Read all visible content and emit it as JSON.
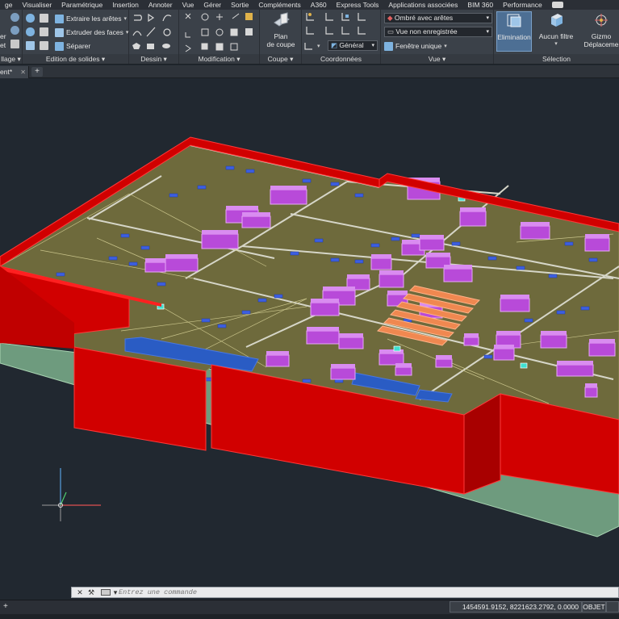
{
  "menu": {
    "items": [
      "ge",
      "Visualiser",
      "Paramétrique",
      "Insertion",
      "Annoter",
      "Vue",
      "Gérer",
      "Sortie",
      "Compléments",
      "A360",
      "Express Tools",
      "Applications associées",
      "BIM 360",
      "Performance"
    ]
  },
  "ribbon": {
    "panel_titles": {
      "maillage": "llage ▾",
      "edition_solides": "Edition de solides ▾",
      "dessin": "Dessin ▾",
      "modification": "Modification ▾",
      "coupe": "Coupe ▾",
      "coordonnees": "Coordonnées",
      "vue": "Vue ▾",
      "selection": "Sélection"
    },
    "solid_edit": {
      "extrude_edges": "Extraire les arêtes",
      "extrude_faces": "Extruder des faces",
      "separate": "Séparer"
    },
    "left_fragments": [
      "er",
      "et"
    ],
    "section_plane": {
      "line1": "Plan",
      "line2": "de coupe"
    },
    "coordinates": {
      "ucs_dropdown": "Général"
    },
    "view": {
      "visual_style": "Ombré avec arêtes",
      "named_view": "Vue non enregistrée",
      "viewport_config": "Fenêtre unique"
    },
    "selection": {
      "culling": "Elimination",
      "no_filter": "Aucun filtre",
      "gizmo_line1": "Gizmo",
      "gizmo_line2": "Déplaceme"
    }
  },
  "document_tab": {
    "label": "ent*",
    "close": "✕",
    "new_tab": "+"
  },
  "command_line": {
    "placeholder": "Entrez une commande",
    "close": "✕",
    "settings": "🔧",
    "arrow": "▾"
  },
  "status": {
    "coordinates": "1454591.9152, 8221623.2792, 0.0000",
    "snap_mode": "OBJET",
    "layout_add": "+"
  },
  "colors": {
    "wall": "#d10000",
    "ground": "#6e9b7e",
    "terrain": "#6e6a3c",
    "buildings": "#b84ad9",
    "highlight": "#f08850",
    "water": "#2a5cc4",
    "ribbon_bg": "#3b4149",
    "viewport_bg": "#212830"
  }
}
